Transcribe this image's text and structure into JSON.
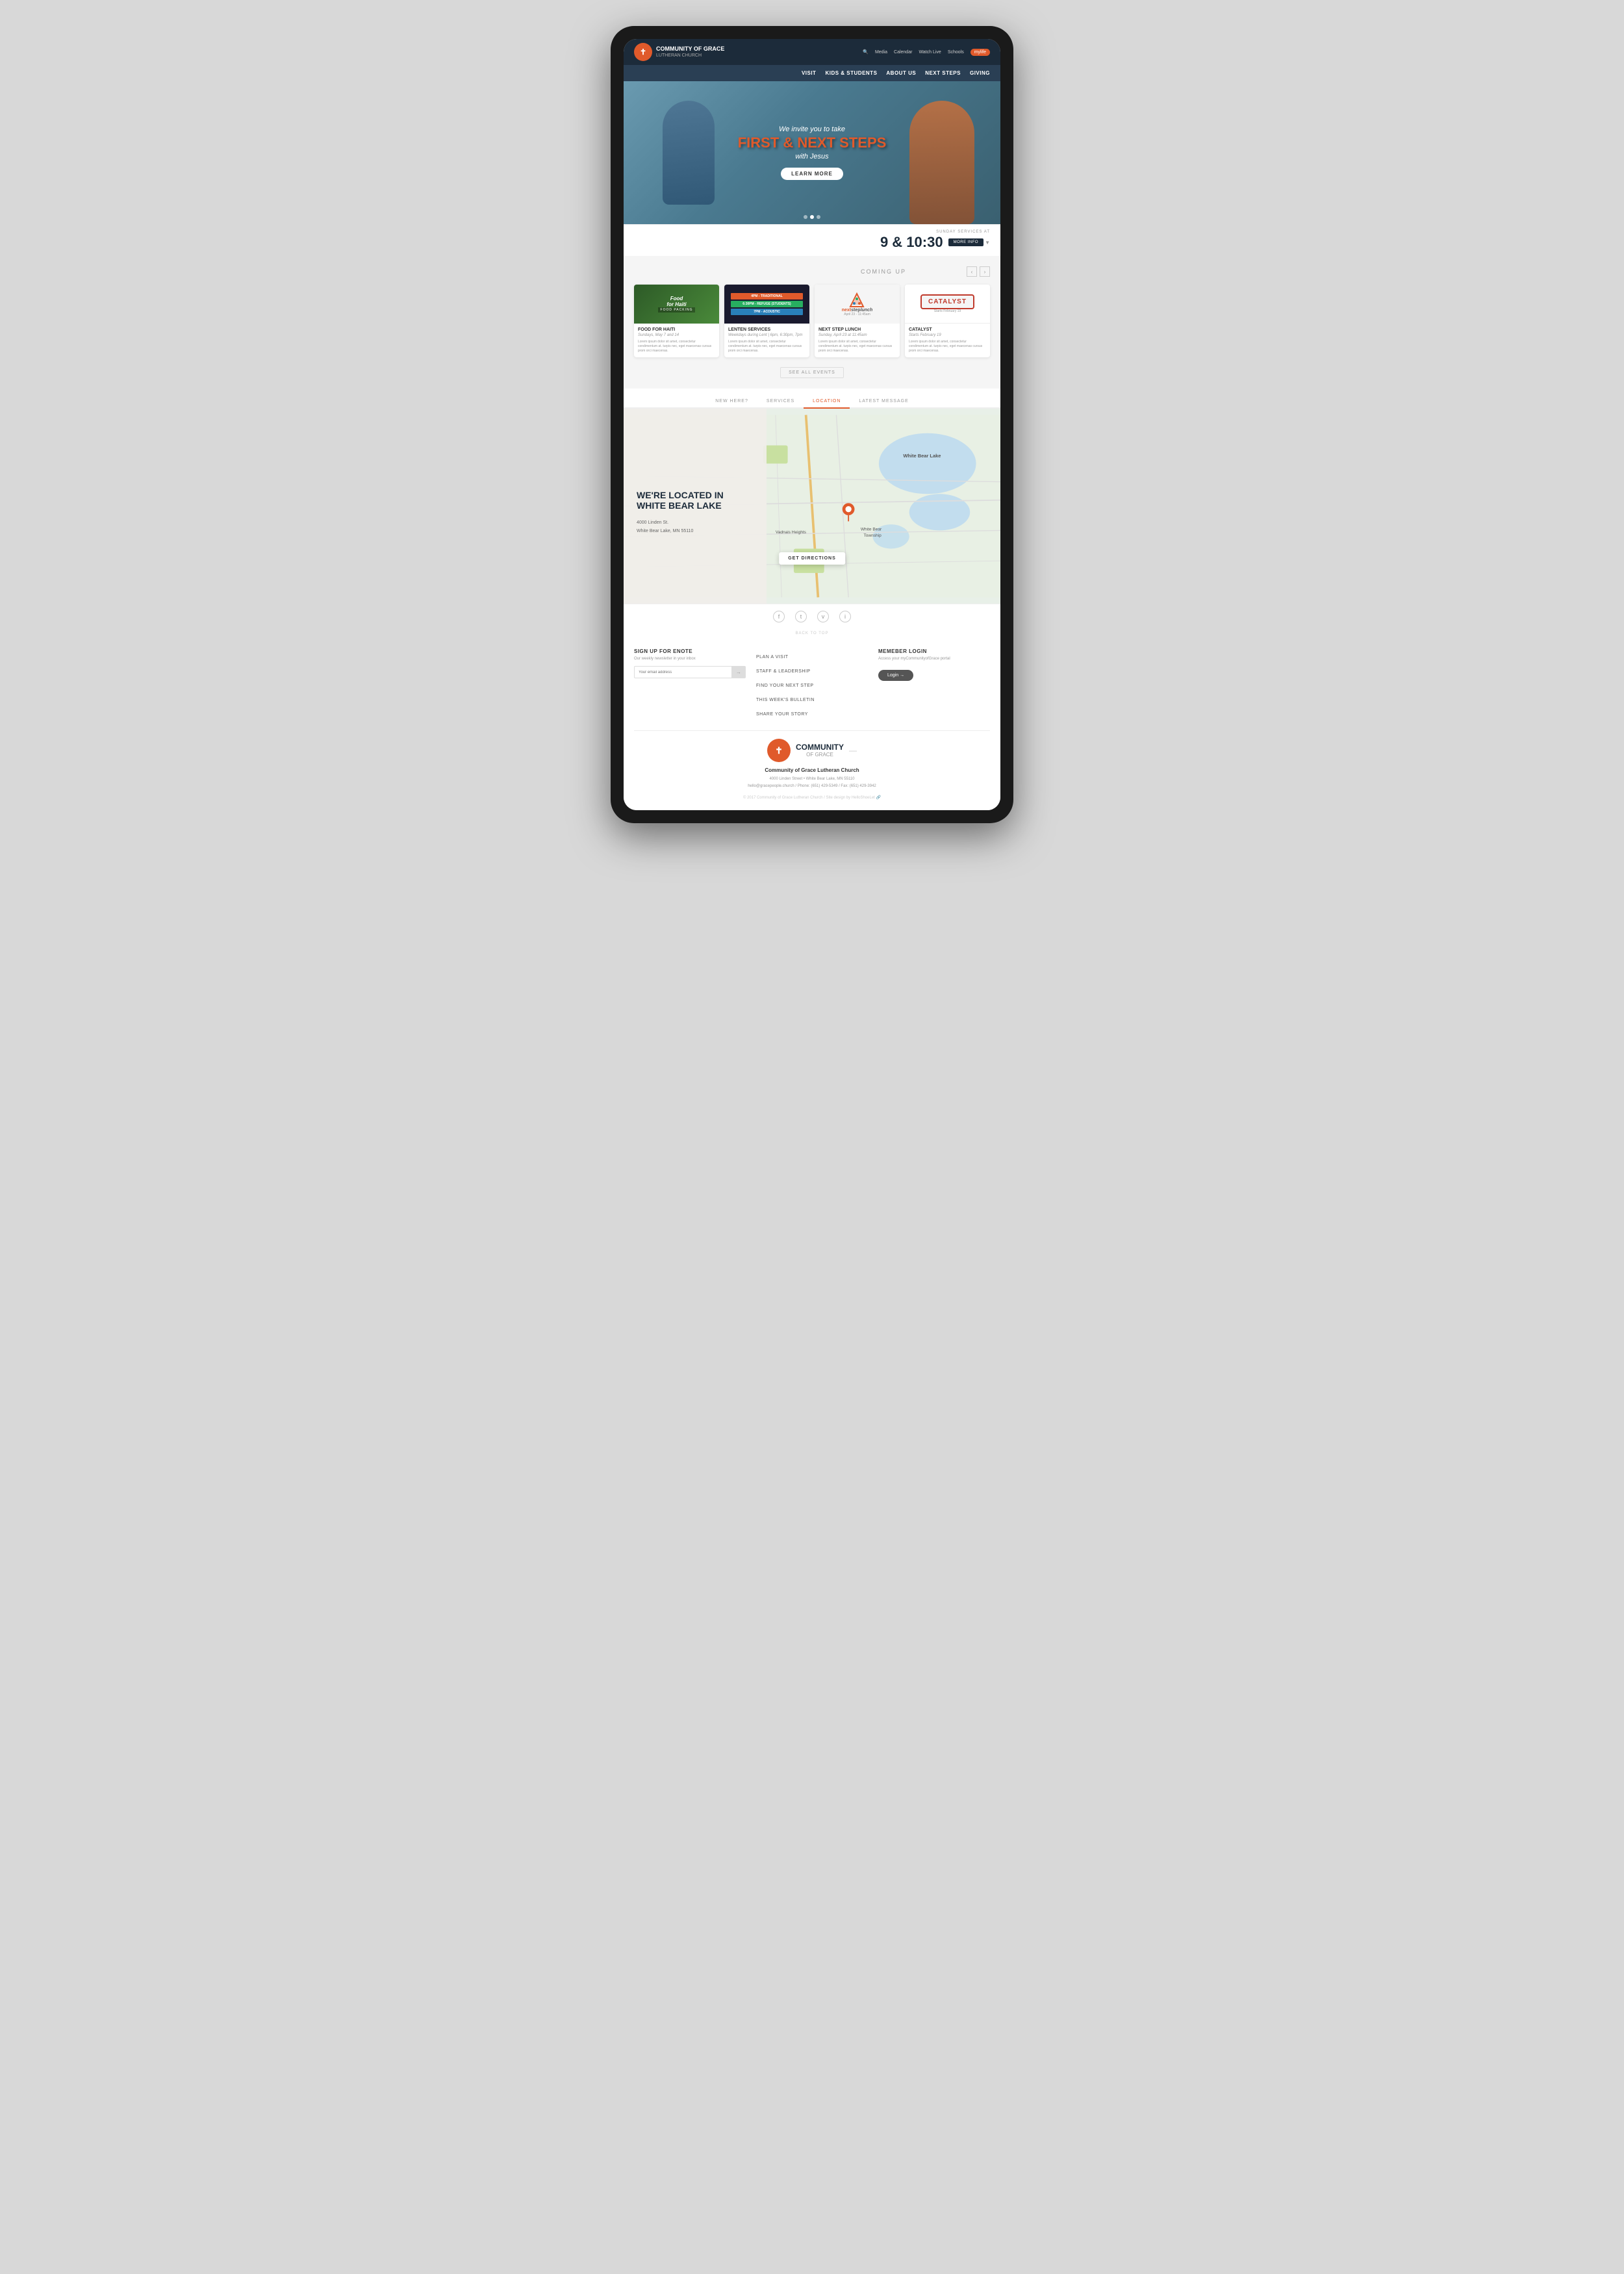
{
  "device": {
    "frame_bg": "#1a1a1a"
  },
  "header": {
    "logo_text": "Community of Grace",
    "logo_subtitle": "Lutheran Church",
    "top_nav": {
      "search": "🔍",
      "media": "Media",
      "calendar": "Calendar",
      "watch_live": "Watch Live",
      "schools": "Schools",
      "my_life": "mylife"
    },
    "main_nav": [
      {
        "label": "Visit"
      },
      {
        "label": "Kids & Students"
      },
      {
        "label": "About Us"
      },
      {
        "label": "Next Steps"
      },
      {
        "label": "Giving"
      }
    ]
  },
  "hero": {
    "subtitle": "We invite you to take",
    "title": "First & Next Steps",
    "with_text": "with Jesus",
    "button_label": "LEARN MORE",
    "dots": [
      {
        "active": false
      },
      {
        "active": true
      },
      {
        "active": false
      }
    ]
  },
  "sunday_services": {
    "label": "SUNDAY SERVICES AT",
    "time": "9 & 10:30",
    "more_info": "MORE INFO"
  },
  "coming_up": {
    "title": "COMING UP",
    "events": [
      {
        "name": "Food for Haiti",
        "date": "Sundays, May 7 and 14",
        "desc": "Lorem ipsum dolor sit amet, consectetur condimentum at. turpis nec, eget maecenas cursus prom orci maecenas.",
        "img_type": "food"
      },
      {
        "name": "Lenten Services",
        "date": "Weekdays during Lent  |  6pm, 6:30pm, 7pm",
        "desc": "Lorem ipsum dolor sit amet, consectetur condimentum at. turpis nec, eget maecenas cursus prom orci maecenas.",
        "img_type": "lenten",
        "bars": [
          {
            "label": "4PM - TRADITIONAL",
            "color": "#e05a2b"
          },
          {
            "label": "6:30PM - REFUGE (STUDENTS)",
            "color": "#27ae60"
          },
          {
            "label": "7PM - ACOUSTIC",
            "color": "#2980b9"
          }
        ]
      },
      {
        "name": "Next Step Lunch",
        "date": "Sunday, April 23 at 11:45am",
        "desc": "Lorem ipsum dolor sit amet, consectetur condimentum at. turpis nec, eget maecenas cursus prom orci maecenas.",
        "img_type": "nextstep"
      },
      {
        "name": "Catalyst",
        "date": "Starts February 19",
        "desc": "Lorem ipsum dolor sit amet, consectetur condimentum at. turpis nec, eget maecenas cursus prom orci maecenas.",
        "img_type": "catalyst"
      }
    ],
    "see_all": "SEE ALL EVENTS"
  },
  "info_tabs": [
    {
      "label": "NEW HERE?",
      "active": false
    },
    {
      "label": "SERVICES",
      "active": false
    },
    {
      "label": "LOCATION",
      "active": true
    },
    {
      "label": "LATEST MESSAGE",
      "active": false
    }
  ],
  "location": {
    "title": "WE'RE LOCATED IN WHITE BEAR LAKE",
    "address_line1": "4000 Linden St.",
    "address_line2": "White Bear Lake, MN 55110",
    "get_directions": "GET DIRECTIONS"
  },
  "social": {
    "icons": [
      "f",
      "t",
      "v",
      "i"
    ],
    "back_to_top": "BACK TO TOP"
  },
  "footer": {
    "enote": {
      "title": "SIGN UP FOR ENOTE",
      "subtitle": "Our weekly newsletter in your inbox",
      "placeholder": "Your email address",
      "button": "→"
    },
    "links": {
      "items": [
        "PLAN A VISIT",
        "STAFF & LEADERSHIP",
        "FIND YOUR NEXT STEP",
        "THIS WEEK'S BULLETIN",
        "SHARE YOUR STORY"
      ]
    },
    "member_login": {
      "title": "MEMEBER LOGIN",
      "subtitle": "Access your myCommunityofGrace portal",
      "button": "Login →"
    },
    "bottom": {
      "logo_text": "Community of Grace",
      "logo_line2": "of Grace",
      "church_name": "Community of Grace Lutheran Church",
      "address": "4000 Linden Street  •  White Bear Lake, MN 55110",
      "phone": "hello@gracepeople.church  /  Phone: (651) 429-5349  /  Fax: (651) 429-3942",
      "copyright": "© 2017 Community of Grace Lutheran Church  /  Site design by HelloShoeLet 🔗"
    }
  }
}
